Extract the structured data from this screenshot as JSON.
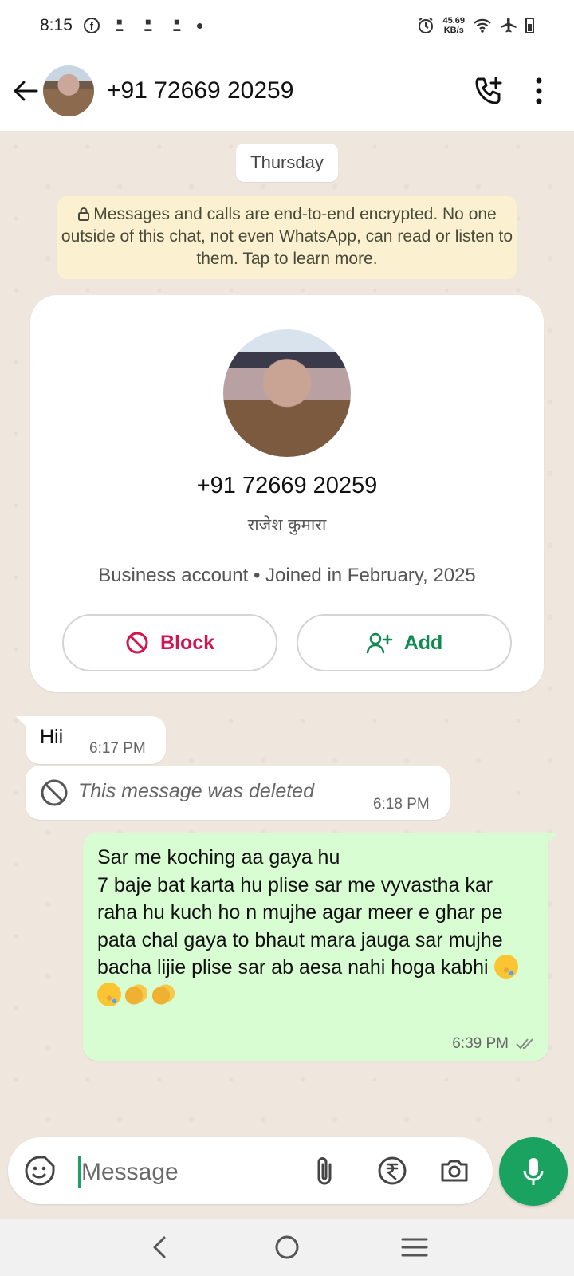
{
  "status_bar": {
    "time": "8:15",
    "network_speed_value": "45.69",
    "network_speed_unit": "KB/s",
    "notification_icons": [
      "facebook-icon",
      "news-app-icon",
      "news-app-icon",
      "news-app-icon"
    ],
    "right_icons": [
      "alarm-icon",
      "wifi-icon",
      "airplane-icon",
      "battery-icon"
    ]
  },
  "header": {
    "contact_title": "+91 72669 20259",
    "actions": [
      "add-call-icon",
      "more-vertical-icon"
    ]
  },
  "chat": {
    "date_chip": "Thursday",
    "encryption_notice": "Messages and calls are end-to-end encrypted. No one outside of this chat, not even WhatsApp, can read or listen to them. Tap to learn more.",
    "contact_card": {
      "phone": "+91 72669 20259",
      "alias": "राजेश कुमारा",
      "meta": "Business account • Joined in February, 2025",
      "block_label": "Block",
      "add_label": "Add"
    },
    "messages": [
      {
        "direction": "incoming",
        "text": "Hii",
        "time": "6:17 PM"
      },
      {
        "direction": "incoming",
        "deleted": true,
        "text": "This message was deleted",
        "time": "6:18 PM"
      },
      {
        "direction": "outgoing",
        "text": "Sar me koching aa gaya hu\n7 baje bat karta hu plise sar me vyvastha kar raha hu kuch ho n mujhe agar meer e ghar pe pata chal gaya to bhaut mara jauga sar mujhe bacha lijie plise sar ab aesa nahi hoga kabhi",
        "emojis": [
          "crying-face-emoji",
          "crying-face-emoji",
          "clapping-hands-emoji",
          "clapping-hands-emoji"
        ],
        "time": "6:39 PM",
        "status": "delivered"
      }
    ]
  },
  "input_bar": {
    "placeholder": "Message",
    "icons": [
      "sticker-icon",
      "attach-icon",
      "rupee-payment-icon",
      "camera-icon",
      "mic-icon"
    ]
  },
  "nav_bar": {
    "buttons": [
      "back-nav",
      "home-nav",
      "recents-nav"
    ]
  },
  "colors": {
    "accent_green": "#1aa260",
    "outgoing_bubble": "#d9fdd3",
    "notice_bg": "#fbf0cf",
    "block_red": "#d2154e",
    "add_green": "#108a52",
    "chat_bg": "#efe7de"
  }
}
